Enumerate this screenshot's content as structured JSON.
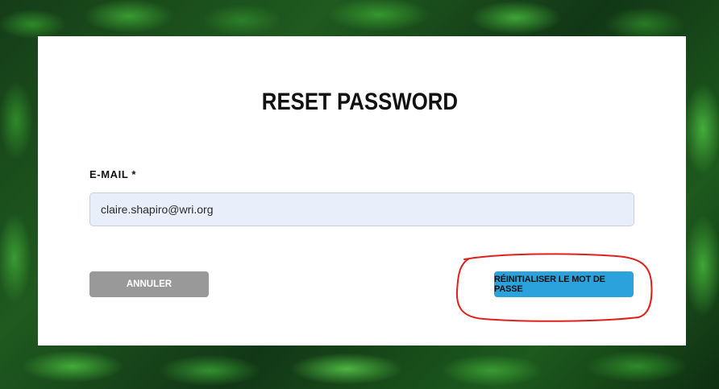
{
  "page": {
    "title": "RESET PASSWORD"
  },
  "form": {
    "email_label": "E-MAIL *",
    "email_value": "claire.shapiro@wri.org"
  },
  "buttons": {
    "cancel_label": "ANNULER",
    "reset_label": "RÉINITIALISER LE MOT DE PASSE"
  },
  "colors": {
    "cancel_button": "#999999",
    "reset_button": "#2ba2dc",
    "input_background": "#e8eefa",
    "annotation_stroke": "#e0201b"
  },
  "icons": {
    "annotation": "red-freehand-circle"
  }
}
